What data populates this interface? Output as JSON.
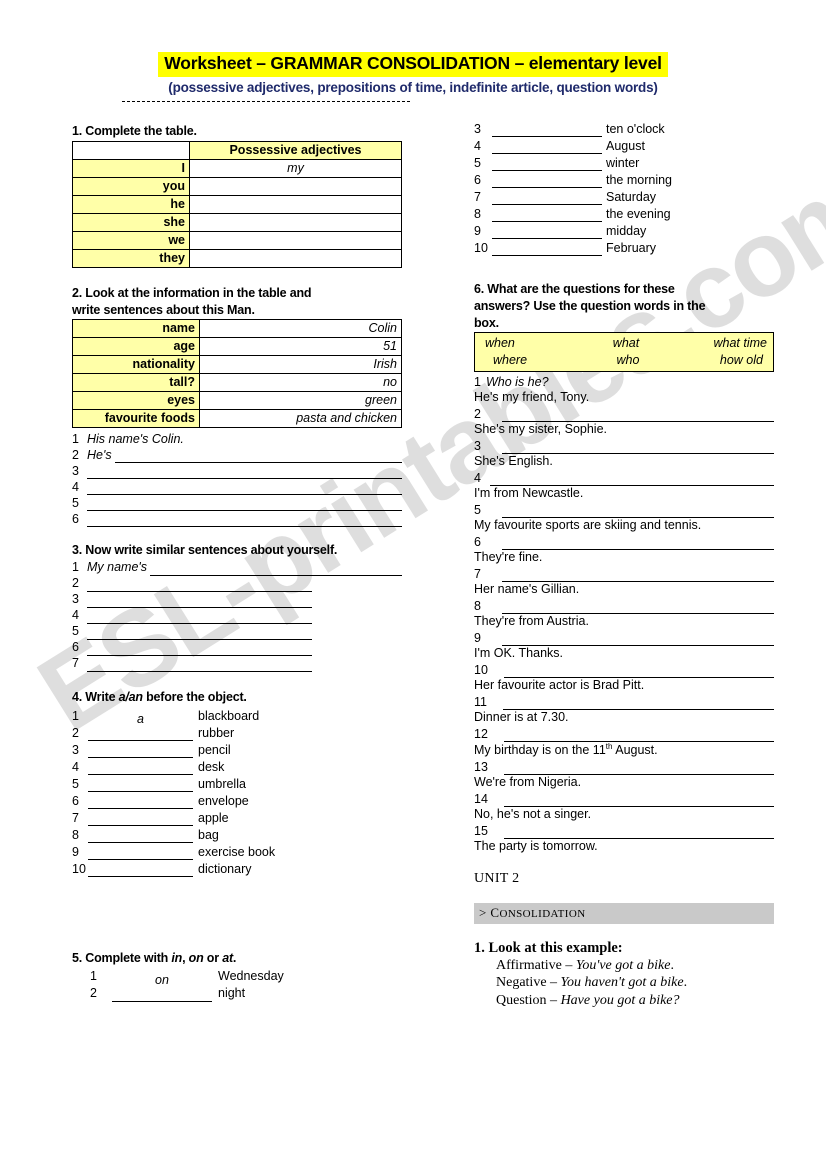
{
  "header": {
    "title": "Worksheet  –  GRAMMAR CONSOLIDATION – elementary level",
    "subtitle": "(possessive adjectives, prepositions of time, indefinite article, question words)",
    "highlight_color": "#FFFF00",
    "subtitle_color": "#1F2A6B"
  },
  "colors": {
    "table_label_fill": "#FFFFA8",
    "band_fill": "#C9C9C9",
    "rule": "#000000"
  },
  "watermark": {
    "text": "ESL-printables.com"
  },
  "ex1": {
    "heading": "1. Complete the table.",
    "col_header_blank": "",
    "col_header": "Possessive adjectives",
    "rows": [
      {
        "pronoun": "I",
        "answer": "my"
      },
      {
        "pronoun": "you",
        "answer": ""
      },
      {
        "pronoun": "he",
        "answer": ""
      },
      {
        "pronoun": "she",
        "answer": ""
      },
      {
        "pronoun": "we",
        "answer": ""
      },
      {
        "pronoun": "they",
        "answer": ""
      }
    ]
  },
  "ex2": {
    "heading_line1": "2. Look at the information in the table and",
    "heading_line2": "write sentences about this Man.",
    "rows": [
      {
        "label": "name",
        "value": "Colin"
      },
      {
        "label": "age",
        "value": "51"
      },
      {
        "label": "nationality",
        "value": "Irish"
      },
      {
        "label": "tall?",
        "value": "no"
      },
      {
        "label": "eyes",
        "value": "green"
      },
      {
        "label": "favourite foods",
        "value": "pasta and chicken"
      }
    ],
    "answers": [
      {
        "num": "1",
        "text": "His name's Colin.",
        "rule": false
      },
      {
        "num": "2",
        "text": "He's",
        "rule": true
      },
      {
        "num": "3",
        "text": "",
        "rule": true
      },
      {
        "num": "4",
        "text": "",
        "rule": true
      },
      {
        "num": "5",
        "text": "",
        "rule": true
      },
      {
        "num": "6",
        "text": "",
        "rule": true
      }
    ]
  },
  "ex3": {
    "heading": "3. Now write similar sentences about yourself.",
    "answers": [
      {
        "num": "1",
        "text": "My name's",
        "long": true
      },
      {
        "num": "2",
        "text": "",
        "long": false
      },
      {
        "num": "3",
        "text": "",
        "long": false
      },
      {
        "num": "4",
        "text": "",
        "long": false
      },
      {
        "num": "5",
        "text": "",
        "long": false
      },
      {
        "num": "6",
        "text": "",
        "long": false
      },
      {
        "num": "7",
        "text": "",
        "long": false
      }
    ]
  },
  "ex4": {
    "heading_pre": "4. Write ",
    "heading_em": "a/an",
    "heading_post": " before the object.",
    "items": [
      {
        "num": "1",
        "answer": "a",
        "word": "blackboard"
      },
      {
        "num": "2",
        "answer": "",
        "word": "rubber"
      },
      {
        "num": "3",
        "answer": "",
        "word": "pencil"
      },
      {
        "num": "4",
        "answer": "",
        "word": "desk"
      },
      {
        "num": "5",
        "answer": "",
        "word": "umbrella"
      },
      {
        "num": "6",
        "answer": "",
        "word": "envelope"
      },
      {
        "num": "7",
        "answer": "",
        "word": "apple"
      },
      {
        "num": "8",
        "answer": "",
        "word": "bag"
      },
      {
        "num": "9",
        "answer": "",
        "word": "exercise book"
      },
      {
        "num": "10",
        "answer": "",
        "word": "dictionary"
      }
    ]
  },
  "ex5": {
    "heading_pre": "5.  Complete with ",
    "heading_em1": "in",
    "heading_mid1": ", ",
    "heading_em2": "on",
    "heading_mid2": " or ",
    "heading_em3": "at",
    "heading_post": ".",
    "left_items": [
      {
        "num": "1",
        "answer": "on",
        "word": "Wednesday"
      },
      {
        "num": "2",
        "answer": "",
        "word": "night"
      }
    ],
    "right_items": [
      {
        "num": "3",
        "answer": "",
        "word": "ten o'clock"
      },
      {
        "num": "4",
        "answer": "",
        "word": "August"
      },
      {
        "num": "5",
        "answer": "",
        "word": "winter"
      },
      {
        "num": "6",
        "answer": "",
        "word": "the morning"
      },
      {
        "num": "7",
        "answer": "",
        "word": "Saturday"
      },
      {
        "num": "8",
        "answer": "",
        "word": "the evening"
      },
      {
        "num": "9",
        "answer": "",
        "word": "midday"
      },
      {
        "num": "10",
        "answer": "",
        "word": "February"
      }
    ]
  },
  "ex6": {
    "heading_line1": "6. What are the questions for these",
    "heading_line2": "answers? Use the question words in the",
    "heading_line3": "box.",
    "wordbox": {
      "row1": [
        "when",
        "what",
        "what time"
      ],
      "row2": [
        "where",
        "who",
        "how old"
      ]
    },
    "pairs": [
      {
        "num": "1",
        "question": "Who is he?",
        "filled": true,
        "answer": "He's my friend, Tony."
      },
      {
        "num": "2",
        "question": "",
        "filled": false,
        "answer": "She's my sister, Sophie."
      },
      {
        "num": "3",
        "question": "",
        "filled": false,
        "answer": "She's English."
      },
      {
        "num": "4",
        "question": "",
        "filled": false,
        "answer": "I'm from Newcastle."
      },
      {
        "num": "5",
        "question": "",
        "filled": false,
        "answer": "My favourite sports are skiing and tennis."
      },
      {
        "num": "6",
        "question": "",
        "filled": false,
        "answer": "They're fine."
      },
      {
        "num": "7",
        "question": "",
        "filled": false,
        "answer": "Her name's Gillian."
      },
      {
        "num": "8",
        "question": "",
        "filled": false,
        "answer": "They're from Austria."
      },
      {
        "num": "9",
        "question": "",
        "filled": false,
        "answer": "I'm OK. Thanks."
      },
      {
        "num": "10",
        "question": "",
        "filled": false,
        "answer": "Her favourite actor is Brad Pitt."
      },
      {
        "num": "11",
        "question": "",
        "filled": false,
        "answer": "Dinner is at 7.30."
      },
      {
        "num": "12",
        "question": "",
        "filled": false,
        "answer_pre": "My birthday is on the 11",
        "answer_sup": "th",
        "answer_post": " August."
      },
      {
        "num": "13",
        "question": "",
        "filled": false,
        "answer": "We're from Nigeria."
      },
      {
        "num": "14",
        "question": "",
        "filled": false,
        "answer": "No, he's not a singer."
      },
      {
        "num": "15",
        "question": "",
        "filled": false,
        "answer": "The party is tomorrow."
      }
    ]
  },
  "unit2": {
    "title": "UNIT 2",
    "band_prefix": "> ",
    "band_first": "C",
    "band_rest": "ONSOLIDATION",
    "look_heading": "1. Look at this example:",
    "items": [
      {
        "label": "Affirmative – ",
        "example": "You've got a bike",
        "tail": "."
      },
      {
        "label": "Negative – ",
        "example": "You haven't got a bike",
        "tail": "."
      },
      {
        "label": "Question – ",
        "example": "Have you got a bike?",
        "tail": ""
      }
    ]
  }
}
